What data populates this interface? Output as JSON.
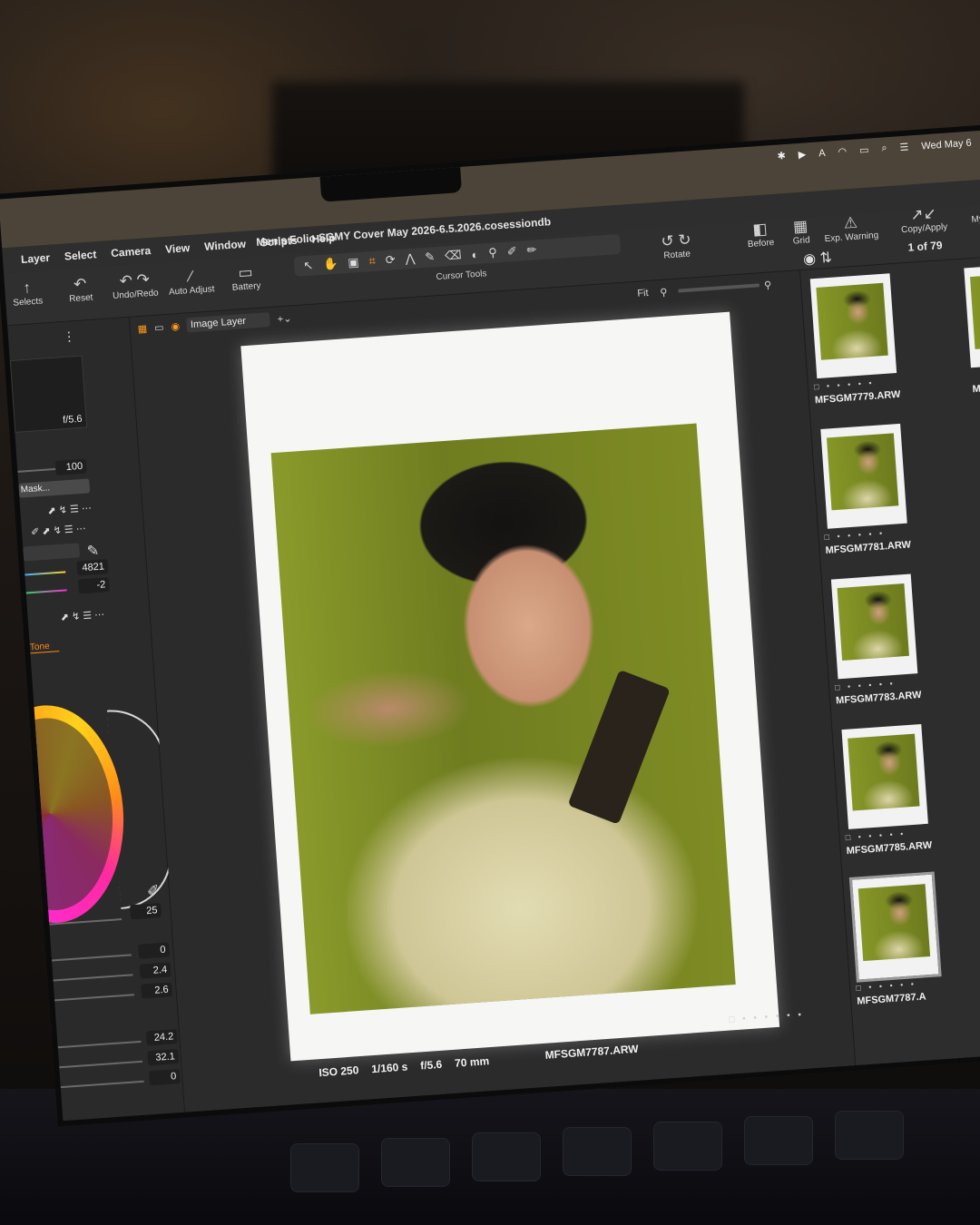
{
  "system": {
    "date": "Wed May 6"
  },
  "app": {
    "menu": [
      "Layer",
      "Select",
      "Camera",
      "View",
      "Window",
      "Scripts",
      "Help"
    ],
    "document_title": "Men's Folio SGMY Cover May 2026-6.5.2026.cosessiondb"
  },
  "toolbar": {
    "left_partial_label": "Selects",
    "reset": "Reset",
    "undo_redo": "Undo/Redo",
    "auto_adjust": "Auto Adjust",
    "battery": "Battery",
    "cursor_tools": "Cursor Tools",
    "rotate": "Rotate",
    "before": "Before",
    "grid": "Grid",
    "exp_warning": "Exp. Warning",
    "copy_apply": "Copy/Apply",
    "right_partial": "My"
  },
  "left_panel": {
    "aperture": "f/5.6",
    "opacity_value": "100",
    "mask_label": "Mask...",
    "kelvin": "4821",
    "tint": "-2",
    "tab_tone": "Tone",
    "value_25": "25",
    "values": [
      "0",
      "2.4",
      "2.6"
    ],
    "values2": [
      "24.2",
      "32.1",
      "0"
    ]
  },
  "viewer": {
    "fit_label": "Fit",
    "layer": "Image Layer",
    "iso": "ISO 250",
    "shutter": "1/160 s",
    "fstop": "f/5.6",
    "focal": "70 mm",
    "filename": "MFSGM7787.ARW",
    "rating_dots": "□ • • • • • ▪"
  },
  "browser": {
    "count": "1 of 79",
    "thumbs": [
      {
        "file": "MFSGM7779.ARW"
      },
      {
        "file": "MFSGM7781.ARW"
      },
      {
        "file": "MFSGM7783.ARW"
      },
      {
        "file": "MFSGM7785.ARW"
      },
      {
        "file": "MFSGM7787.A"
      }
    ],
    "partial_label": "MFSG"
  },
  "colors": {
    "accent": "#ff9a1a",
    "panel": "#2a2a2a"
  }
}
